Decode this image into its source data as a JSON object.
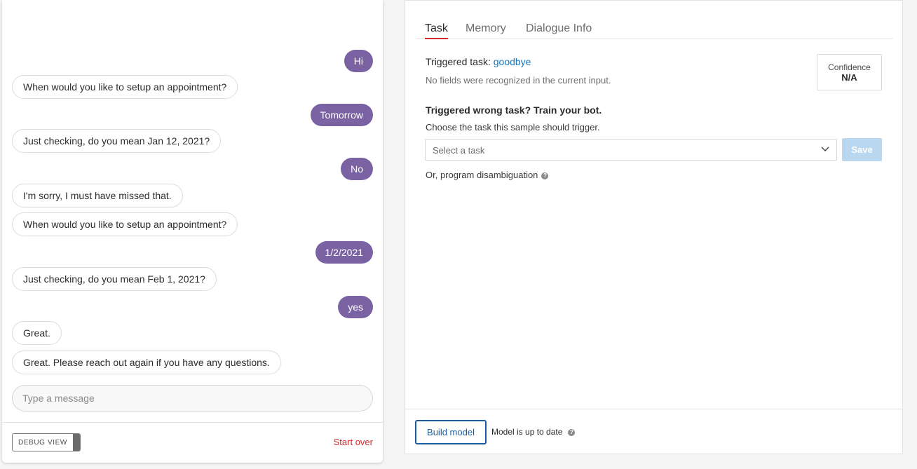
{
  "chat": {
    "messages": [
      {
        "sender": "user",
        "text": "Hi"
      },
      {
        "sender": "bot",
        "text": "When would you like to setup an appointment?"
      },
      {
        "sender": "user",
        "text": "Tomorrow"
      },
      {
        "sender": "bot",
        "text": "Just checking, do you mean Jan 12, 2021?"
      },
      {
        "sender": "user",
        "text": "No"
      },
      {
        "sender": "bot",
        "text": "I'm sorry, I must have missed that."
      },
      {
        "sender": "bot",
        "text": "When would you like to setup an appointment?"
      },
      {
        "sender": "user",
        "text": "1/2/2021"
      },
      {
        "sender": "bot",
        "text": "Just checking, do you mean Feb 1, 2021?"
      },
      {
        "sender": "user",
        "text": "yes"
      },
      {
        "sender": "bot",
        "text": "Great."
      },
      {
        "sender": "bot",
        "text": "Great. Please reach out again if you have any questions."
      }
    ],
    "input_placeholder": "Type a message",
    "input_value": "",
    "debug_label": "DEBUG VIEW",
    "start_over_label": "Start over"
  },
  "panel": {
    "tabs": [
      {
        "label": "Task",
        "active": true
      },
      {
        "label": "Memory",
        "active": false
      },
      {
        "label": "Dialogue Info",
        "active": false
      }
    ],
    "triggered_label": "Triggered task:",
    "triggered_task": "goodbye",
    "no_fields_text": "No fields were recognized in the current input.",
    "confidence_label": "Confidence",
    "confidence_value": "N/A",
    "wrong_task_heading": "Triggered wrong task? Train your bot.",
    "choose_text": "Choose the task this sample should trigger.",
    "select_placeholder": "Select a task",
    "save_label": "Save",
    "disambiguation_text": "Or, program disambiguation",
    "build_label": "Build model",
    "model_status": "Model is up to date"
  },
  "colors": {
    "user_bubble": "#7b62a3",
    "active_tab_underline": "#d12a2a",
    "link": "#1479c4",
    "start_over": "#d12a2a",
    "build_button": "#1a5d9c",
    "save_disabled": "#b9d7ee"
  },
  "icons": [
    "chevron-down-icon",
    "help-circle-icon"
  ]
}
